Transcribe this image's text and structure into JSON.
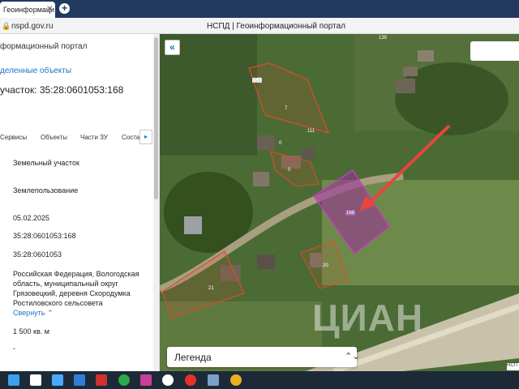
{
  "browser": {
    "tab_title": "Геоинформаци",
    "tab_close": "✕",
    "new_tab": "+",
    "url": "nspd.gov.ru",
    "page_title": "НСПД | Геоинформационный портал"
  },
  "sidebar": {
    "header": "формационный портал",
    "selected_link": "деленные объекты",
    "parcel_title": "участок: 35:28:0601053:168",
    "tabs": [
      "Сервисы",
      "Объекты",
      "Части ЗУ",
      "Соста"
    ],
    "tab_scroll": "▸",
    "fields": {
      "type": "Земельный участок",
      "kind": "Землепользование",
      "date": "05.02.2025",
      "cadastral_number": "35:28:0601053:168",
      "quarter": "35:28:0601053",
      "address": "Российская Федерация, Вологодская область, муниципальный округ Грязовецкий, деревня Скородумка Ростиловского сельсовета",
      "show_less": "Свернуть",
      "area": "1 500 кв. м",
      "dash": "-"
    }
  },
  "map": {
    "collapse_icon": "«",
    "legend_label": "Легенда",
    "legend_chevron": "⌃⌄",
    "parcel_labels": [
      "140",
      "7",
      "111",
      "168",
      "20",
      "21",
      "139",
      "0",
      "0"
    ],
    "watermark": "ЦИАН",
    "corner_tag": "НСП"
  },
  "colors": {
    "selected_parcel": "#9c2b9c",
    "parcel_outline": "#e04a2a",
    "arrow": "#e8453c",
    "link": "#1a73c7"
  },
  "taskbar_icons": [
    "windows-start-icon",
    "search-icon",
    "task-view-icon",
    "mail-icon",
    "app-icon",
    "check-icon",
    "photos-icon",
    "yandex-browser-icon",
    "yandex-icon",
    "camera-icon",
    "chrome-icon"
  ]
}
